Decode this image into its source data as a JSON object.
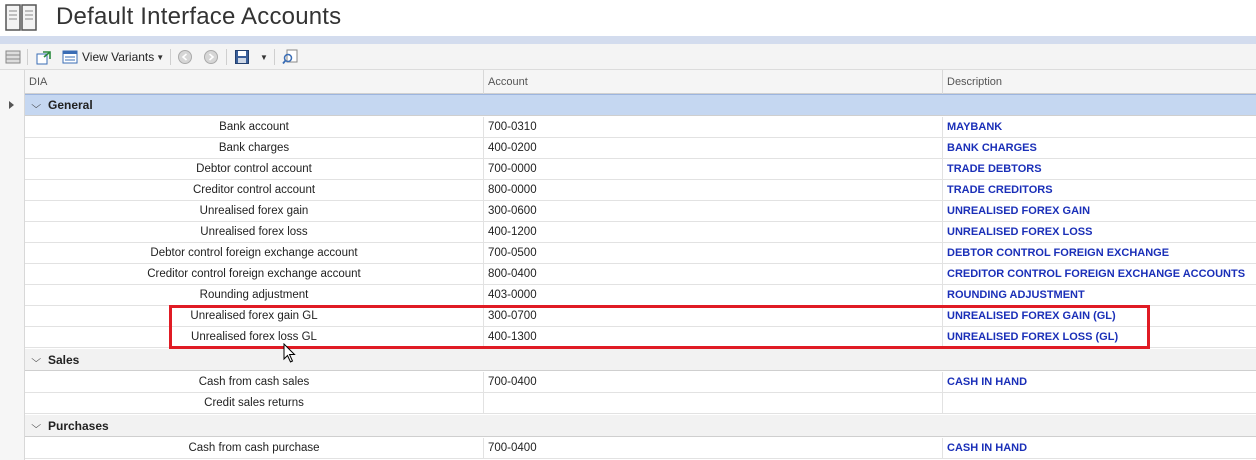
{
  "window": {
    "title": "Default Interface Accounts",
    "icon": "book-icon"
  },
  "toolbar": {
    "view_variants_label": "View Variants",
    "icons": [
      "grid-icon",
      "export-icon",
      "view-variants-icon",
      "previous-icon",
      "next-icon",
      "save-icon",
      "dropdown-icon",
      "search-icon"
    ]
  },
  "grid": {
    "columns": [
      "DIA",
      "Account",
      "Description"
    ],
    "groups": [
      {
        "name": "General",
        "rows": [
          {
            "dia": "Bank account",
            "account": "700-0310",
            "description": "MAYBANK"
          },
          {
            "dia": "Bank charges",
            "account": "400-0200",
            "description": "BANK CHARGES"
          },
          {
            "dia": "Debtor control account",
            "account": "700-0000",
            "description": "TRADE DEBTORS"
          },
          {
            "dia": "Creditor control account",
            "account": "800-0000",
            "description": "TRADE CREDITORS"
          },
          {
            "dia": "Unrealised forex gain",
            "account": "300-0600",
            "description": "UNREALISED FOREX GAIN"
          },
          {
            "dia": "Unrealised forex loss",
            "account": "400-1200",
            "description": "UNREALISED FOREX LOSS"
          },
          {
            "dia": "Debtor control foreign exchange account",
            "account": "700-0500",
            "description": "DEBTOR CONTROL FOREIGN EXCHANGE"
          },
          {
            "dia": "Creditor control foreign exchange account",
            "account": "800-0400",
            "description": "CREDITOR CONTROL FOREIGN EXCHANGE ACCOUNTS"
          },
          {
            "dia": "Rounding adjustment",
            "account": "403-0000",
            "description": "ROUNDING ADJUSTMENT"
          },
          {
            "dia": "Unrealised forex gain GL",
            "account": "300-0700",
            "description": "UNREALISED FOREX GAIN (GL)"
          },
          {
            "dia": "Unrealised forex loss GL",
            "account": "400-1300",
            "description": "UNREALISED FOREX LOSS (GL)"
          }
        ]
      },
      {
        "name": "Sales",
        "rows": [
          {
            "dia": "Cash from cash sales",
            "account": "700-0400",
            "description": "CASH IN HAND"
          },
          {
            "dia": "Credit sales returns",
            "account": "",
            "description": ""
          }
        ]
      },
      {
        "name": "Purchases",
        "rows": [
          {
            "dia": "Cash from cash purchase",
            "account": "700-0400",
            "description": "CASH IN HAND"
          }
        ]
      }
    ]
  },
  "colors": {
    "group_selected_bg": "#c5d7f1",
    "description_text": "#1a2fb8",
    "highlight_border": "#e01b24"
  }
}
